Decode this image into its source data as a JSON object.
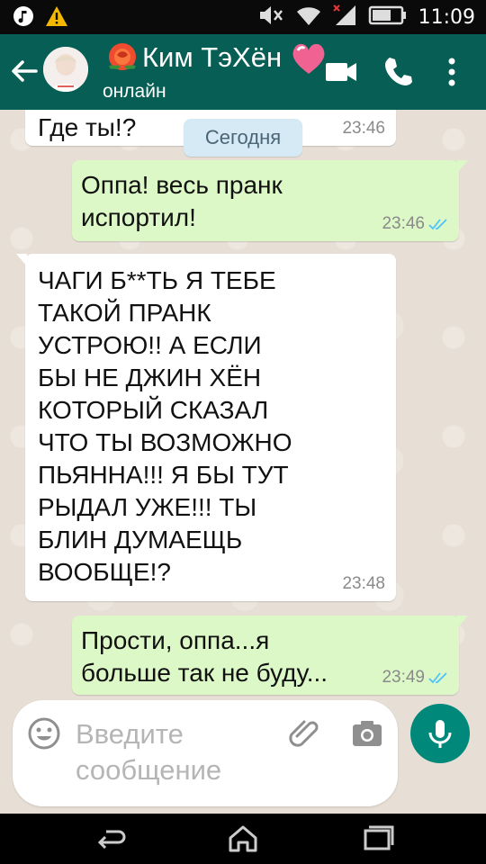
{
  "status_bar": {
    "time": "11:09",
    "icons": [
      "music-icon",
      "warning-icon",
      "mute-icon",
      "wifi-icon",
      "signal-icon",
      "battery-icon"
    ]
  },
  "header": {
    "contact_name": "Ким ТэХён",
    "status": "онлайн",
    "icons": [
      "back-arrow-icon",
      "rose-emoji-icon",
      "heart-emoji-icon",
      "video-call-icon",
      "phone-icon",
      "more-icon"
    ],
    "colors": {
      "app_bar": "#075e54"
    }
  },
  "chat": {
    "date_chip": "Сегодня",
    "messages": [
      {
        "direction": "in",
        "text": "Где ты!?",
        "time": "23:46"
      },
      {
        "direction": "out",
        "text": "Оппа! весь пранк\nиспортил!",
        "time": "23:46",
        "read": true
      },
      {
        "direction": "in",
        "text": "ЧАГИ Б**ТЬ Я ТЕБЕ\nТАКОЙ ПРАНК\nУСТРОЮ!! А ЕСЛИ\nБЫ НЕ ДЖИН ХЁН\nКОТОРЫЙ СКАЗАЛ\nЧТО ТЫ ВОЗМОЖНО\nПЬЯННА!!! Я БЫ ТУТ\nРЫДАЛ УЖЕ!!! ТЫ\nБЛИН ДУМАЕЩЬ\nВООБЩЕ!?",
        "time": "23:48"
      },
      {
        "direction": "out",
        "text": "Прости, оппа...я\nбольше так не буду...",
        "time": "23:49",
        "read": true
      }
    ],
    "colors": {
      "incoming": "#ffffff",
      "outgoing": "#dcf8c6",
      "read_ticks": "#4fc3f7"
    }
  },
  "composer": {
    "placeholder": "Введите\nсообщение",
    "icons": [
      "emoji-icon",
      "attach-icon",
      "camera-icon",
      "mic-icon"
    ],
    "colors": {
      "mic_button": "#00897b"
    }
  },
  "nav_bar": {
    "icons": [
      "back-nav-icon",
      "home-icon",
      "recents-icon"
    ]
  }
}
